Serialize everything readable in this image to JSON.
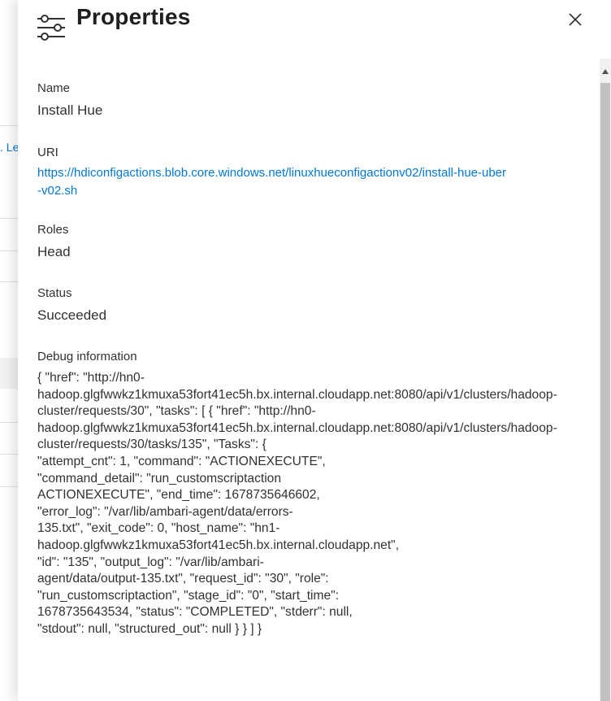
{
  "background": {
    "link_fragment": ". Le"
  },
  "panel": {
    "title": "Properties",
    "header_icon": "settings-sliders-icon",
    "close_icon": "close-icon"
  },
  "fields": {
    "name_label": "Name",
    "name_value": "Install Hue",
    "uri_label": "URI",
    "uri_value": "https://hdiconfigactions.blob.core.windows.net/linuxhueconfigactionv02/install-hue-uber-v02.sh",
    "roles_label": "Roles",
    "roles_value": "Head",
    "status_label": "Status",
    "status_value": "Succeeded",
    "debug_label": "Debug information",
    "debug_lines": [
      "{ \"href\": \"http://hn0-",
      "hadoop.glgfwwkz1kmuxa53fort41ec5h.bx.internal.cloudapp.net:8080/api/v1/clusters/hadoop-",
      "cluster/requests/30\", \"tasks\": [ { \"href\": \"http://hn0-",
      "hadoop.glgfwwkz1kmuxa53fort41ec5h.bx.internal.cloudapp.net:8080/api/v1/clusters/hadoop-",
      "cluster/requests/30/tasks/135\", \"Tasks\": {",
      "\"attempt_cnt\": 1, \"command\": \"ACTIONEXECUTE\",",
      "\"command_detail\": \"run_customscriptaction",
      "ACTIONEXECUTE\", \"end_time\": 1678735646602,",
      "\"error_log\": \"/var/lib/ambari-agent/data/errors-",
      "135.txt\", \"exit_code\": 0, \"host_name\": \"hn1-",
      "hadoop.glgfwwkz1kmuxa53fort41ec5h.bx.internal.cloudapp.net\",",
      "\"id\": \"135\", \"output_log\": \"/var/lib/ambari-",
      "agent/data/output-135.txt\", \"request_id\": \"30\", \"role\":",
      "\"run_customscriptaction\", \"stage_id\": \"0\", \"start_time\":",
      "1678735643534, \"status\": \"COMPLETED\", \"stderr\": null,",
      "\"stdout\": null, \"structured_out\": null } } ] }"
    ]
  },
  "colors": {
    "link": "#0078d4",
    "text": "#323130",
    "title": "#201f1e"
  }
}
